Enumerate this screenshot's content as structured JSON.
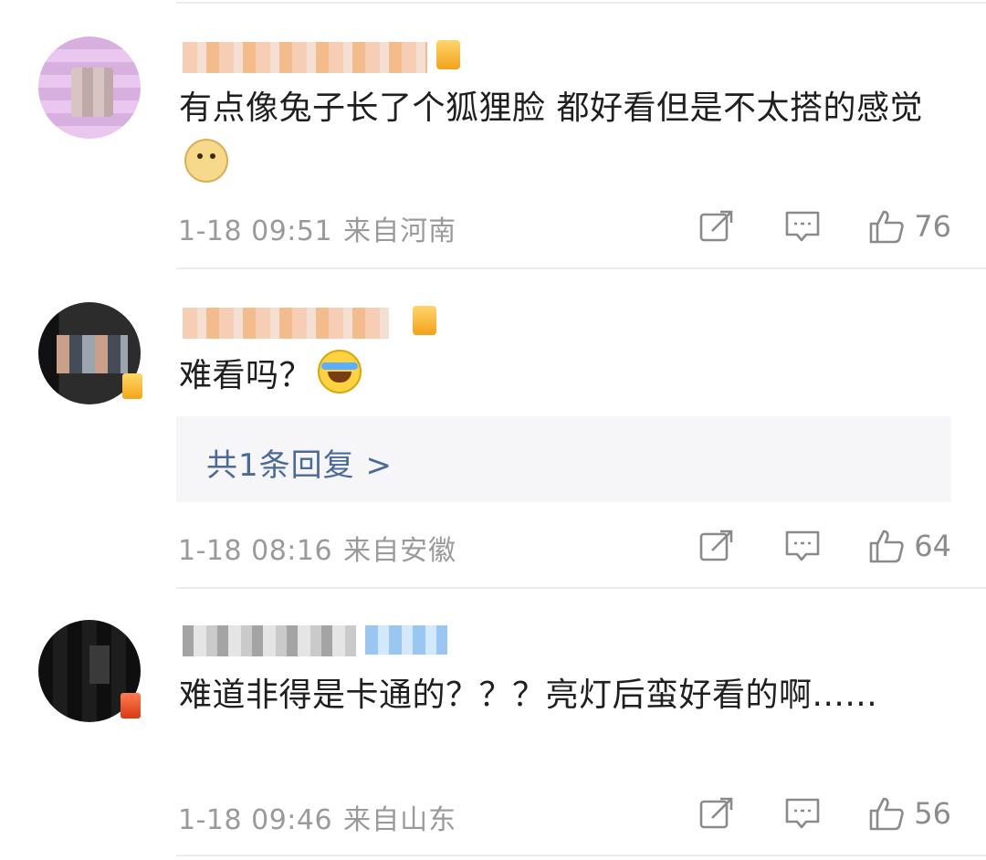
{
  "comments": [
    {
      "text": "有点像兔子长了个狐狸脸 都好看但是不太搭的感觉",
      "emoji": "doge-emoji",
      "time": "1-18 09:51",
      "location": "来自河南",
      "likes": "76"
    },
    {
      "text": "难看吗？",
      "emoji": "laugh-cry-emoji",
      "reply_summary": "共1条回复 >",
      "time": "1-18 08:16",
      "location": "来自安徽",
      "likes": "64"
    },
    {
      "text": "难道非得是卡通的？？？亮灯后蛮好看的啊......",
      "time": "1-18 09:46",
      "location": "来自山东",
      "likes": "56"
    }
  ],
  "icons": {
    "share": "share-icon",
    "comment": "comment-icon",
    "like": "thumbs-up-icon"
  },
  "colors": {
    "background": "#ffffff",
    "meta_text": "#9a9a9a",
    "reply_link": "#4b6a99",
    "reply_box": "#f6f6f8",
    "divider": "#ececec"
  }
}
